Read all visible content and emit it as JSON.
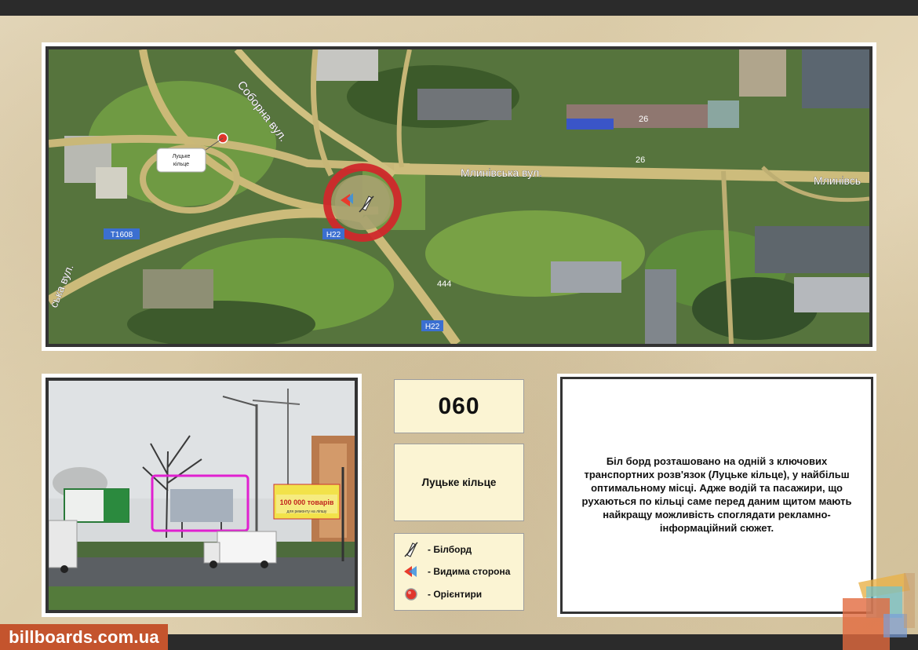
{
  "map": {
    "streets": {
      "soborna": "Соборна вул.",
      "mlynivska_1": "Млинівська вул.",
      "mlynivska_2": "Млинівсь",
      "lutska_left": "ська вул."
    },
    "road_badges": {
      "t1608": "Т1608",
      "h22_a": "Н22",
      "h22_b": "Н22"
    },
    "house_numbers": {
      "n26_a": "26",
      "n26_b": "26",
      "n444": "444"
    },
    "landmark_label": {
      "line1": "Луцьке",
      "line2": "кільце"
    }
  },
  "board": {
    "code": "060",
    "place": "Луцьке кільце"
  },
  "legend": {
    "billboard": "- Білборд",
    "visible_side": "- Видима сторона",
    "landmarks": "- Орієнтири"
  },
  "description": "Біл борд розташовано на одній з ключових транспортних розв'язок (Луцьке кільце), у найбільш оптимальному місці. Адже водій та пасажири, що рухаються по кільці саме перед даним щитом мають найкращу можливість споглядати рекламно-інформаційний сюжет.",
  "brand": "billboards.com.ua",
  "photo": {
    "sign_right_1": "100 000 товарів",
    "sign_right_2": "для ремонту на ліпшу"
  },
  "colors": {
    "marker_ring": "#d0282b",
    "highlight_frame": "#e020d0",
    "brand_bg": "#c4542d",
    "info_box_bg": "#fbf4d3"
  }
}
